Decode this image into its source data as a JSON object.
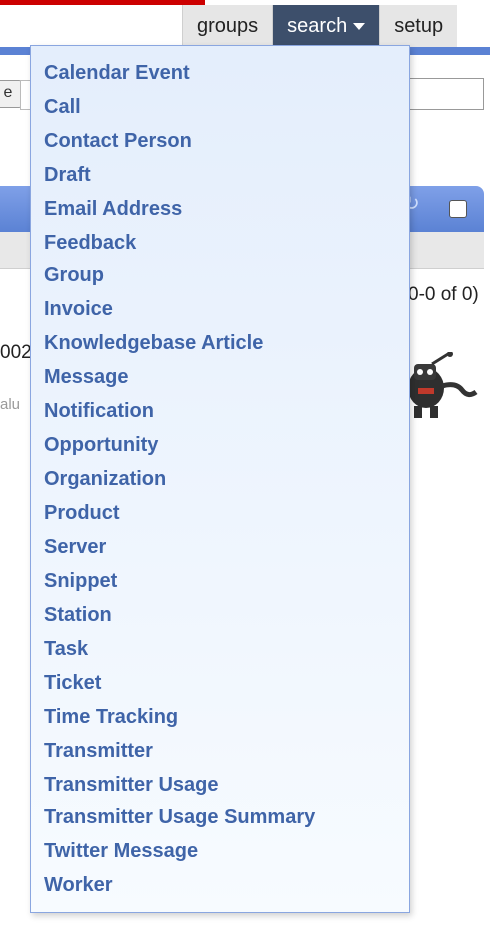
{
  "nav": {
    "tabs": [
      {
        "label": "groups"
      },
      {
        "label": "search",
        "active": true
      },
      {
        "label": "setup"
      }
    ]
  },
  "background": {
    "count_text": "0-0 of 0)",
    "left_fragment_1": "002-",
    "left_fragment_2": "alu"
  },
  "dropdown": {
    "items": [
      "Calendar Event",
      "Call",
      "Contact Person",
      "Draft",
      "Email Address",
      "Feedback",
      "Group",
      "Invoice",
      "Knowledgebase Article",
      "Message",
      "Notification",
      "Opportunity",
      "Organization",
      "Product",
      "Server",
      "Snippet",
      "Station",
      "Task",
      "Ticket",
      "Time Tracking",
      "Transmitter",
      "Transmitter Usage",
      "Transmitter Usage Summary",
      "Twitter Message",
      "Worker"
    ]
  },
  "colors": {
    "accent_blue": "#5b82d4",
    "active_tab": "#3d4f6b",
    "menu_text": "#3f64a8"
  }
}
